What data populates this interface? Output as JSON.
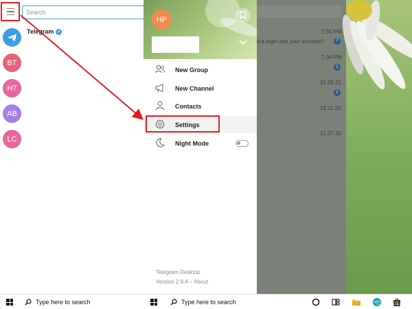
{
  "search": {
    "placeholder": "Search"
  },
  "chats": {
    "first_name": "Telegram",
    "avatars": [
      "BT",
      "H7",
      "AB",
      "LC"
    ]
  },
  "background_chat": {
    "times": [
      "7:35 PM",
      "7:04 PM",
      "31.05.21",
      "18.11.20",
      "21.07.20"
    ],
    "preview": "d a login into your account f",
    "badges": [
      "7",
      "1",
      "1"
    ]
  },
  "drawer": {
    "avatar_initials": "HP",
    "items": [
      {
        "label": "New Group",
        "icon": "group-icon"
      },
      {
        "label": "New Channel",
        "icon": "megaphone-icon"
      },
      {
        "label": "Contacts",
        "icon": "person-icon"
      },
      {
        "label": "Settings",
        "icon": "gear-icon"
      },
      {
        "label": "Night Mode",
        "icon": "moon-icon"
      }
    ],
    "night_mode_on": false,
    "footer_title": "Telegram Desktop",
    "footer_version": "Version 2.8.4 – About"
  },
  "taskbar": {
    "search_text_1": "Type here to search",
    "search_text_2": "Type here to search"
  },
  "colors": {
    "accent": "#4da0d8",
    "annotation": "#e02020",
    "avatar_bt": "#e8627a",
    "avatar_h7": "#e8679e",
    "avatar_ab": "#a77ee6",
    "avatar_lc": "#e8679e",
    "avatar_hp": "#f08a4e",
    "badge": "#3d8fd6"
  }
}
